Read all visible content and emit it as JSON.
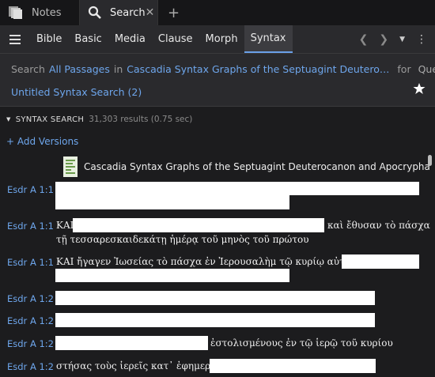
{
  "tabs": [
    {
      "label": "Notes"
    },
    {
      "label": "Search"
    }
  ],
  "toolbar": {
    "buttons": [
      "Bible",
      "Basic",
      "Media",
      "Clause",
      "Morph",
      "Syntax"
    ],
    "active": "Syntax"
  },
  "search": {
    "prefix": "Search",
    "scope": "All Passages",
    "in_word": "in",
    "resource": "Cascadia Syntax Graphs of the Septuagint Deutero…",
    "for_word": "for",
    "query": "Query",
    "saved_name": "Untitled Syntax Search (2)"
  },
  "results": {
    "section_title": "SYNTAX SEARCH",
    "count": "31,303 results (0.75 sec)",
    "add_versions": "+ Add Versions",
    "source_title": "Cascadia Syntax Graphs of the Septuagint Deuterocanon and Apocrypha",
    "rows": [
      {
        "ref": "Esdr A 1:1",
        "line1": "",
        "line2": ""
      },
      {
        "ref": "Esdr A 1:1",
        "line1": "ΚΑΙ",
        "line1_end": "καὶ ἔθυσαν τὸ πάσχα",
        "line2": "τῇ τεσσαρεσκαιδεκάτῃ ἡμέρᾳ τοῦ μηνὸς τοῦ πρώτου"
      },
      {
        "ref": "Esdr A 1:1",
        "line1": "ΚΑΙ ἤγαγεν Ἰωσείας τὸ πάσχα ἐν Ἰερουσαλὴμ τῷ κυρίῳ αὐτοῦ καὶ",
        "line2": ""
      },
      {
        "ref": "Esdr A 1:2",
        "line1": ""
      },
      {
        "ref": "Esdr A 1:2",
        "line1": ""
      },
      {
        "ref": "Esdr A 1:2",
        "line1": "ἐστολισμένους ἐν τῷ ἱερῷ τοῦ κυρίου"
      },
      {
        "ref": "Esdr A 1:2",
        "line1": "στήσας τοὺς ἱερεῖς κατ᾽ ἐφημερίας"
      }
    ]
  },
  "colors": {
    "link": "#6ea6ec",
    "background": "#1c1c1e",
    "panel": "#2a2a2d"
  }
}
